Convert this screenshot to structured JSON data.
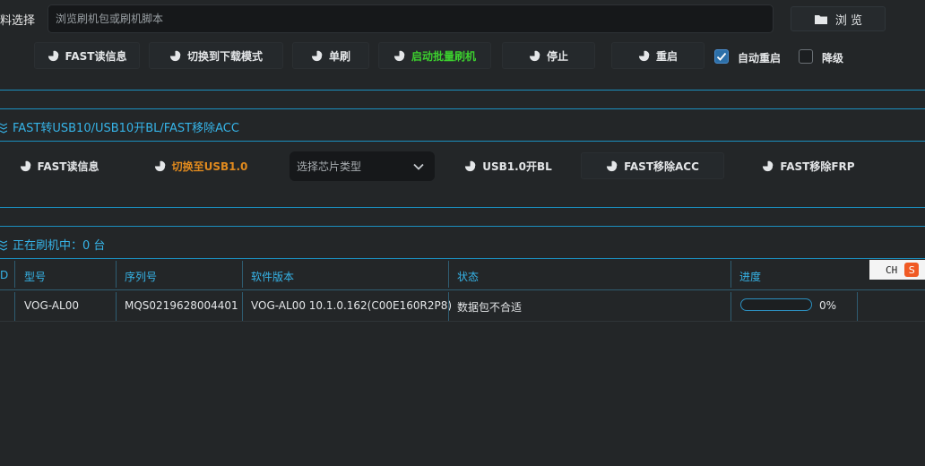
{
  "top": {
    "file_label": "料选择",
    "path_placeholder": "浏览刷机包或刷机脚本",
    "browse_label": "浏 览"
  },
  "actions": {
    "fast_read": "FAST读信息",
    "switch_download": "切换到下载模式",
    "single_flash": "单刷",
    "batch_flash": "启动批量刷机",
    "stop": "停止",
    "reboot": "重启",
    "auto_reboot": "自动重启",
    "auto_reboot_checked": true,
    "downgrade": "降级",
    "downgrade_checked": false
  },
  "fast_section": {
    "title": "FAST转USB10/USB10开BL/FAST移除ACC",
    "fast_read": "FAST读信息",
    "switch_usb": "切换至USB1.0",
    "chip_placeholder": "选择芯片类型",
    "usb_unlock": "USB1.0开BL",
    "remove_acc": "FAST移除ACC",
    "remove_frp": "FAST移除FRP"
  },
  "flashing": {
    "title": "正在刷机中：0 台",
    "columns": [
      "D",
      "型号",
      "序列号",
      "软件版本",
      "状态",
      "进度"
    ],
    "row": {
      "model": "VOG-AL00",
      "serial": "MQS0219628004401",
      "version": "VOG-AL00 10.1.0.162(C00E160R2P8)",
      "status": "数据包不合适",
      "progress_text": "0%",
      "progress_value": 0
    }
  },
  "ime": {
    "lang": "CH",
    "logo": "S"
  },
  "colors": {
    "accent": "#36b4e8",
    "green": "#3ccf2e",
    "orange": "#e08a1e",
    "bg": "#232628"
  }
}
